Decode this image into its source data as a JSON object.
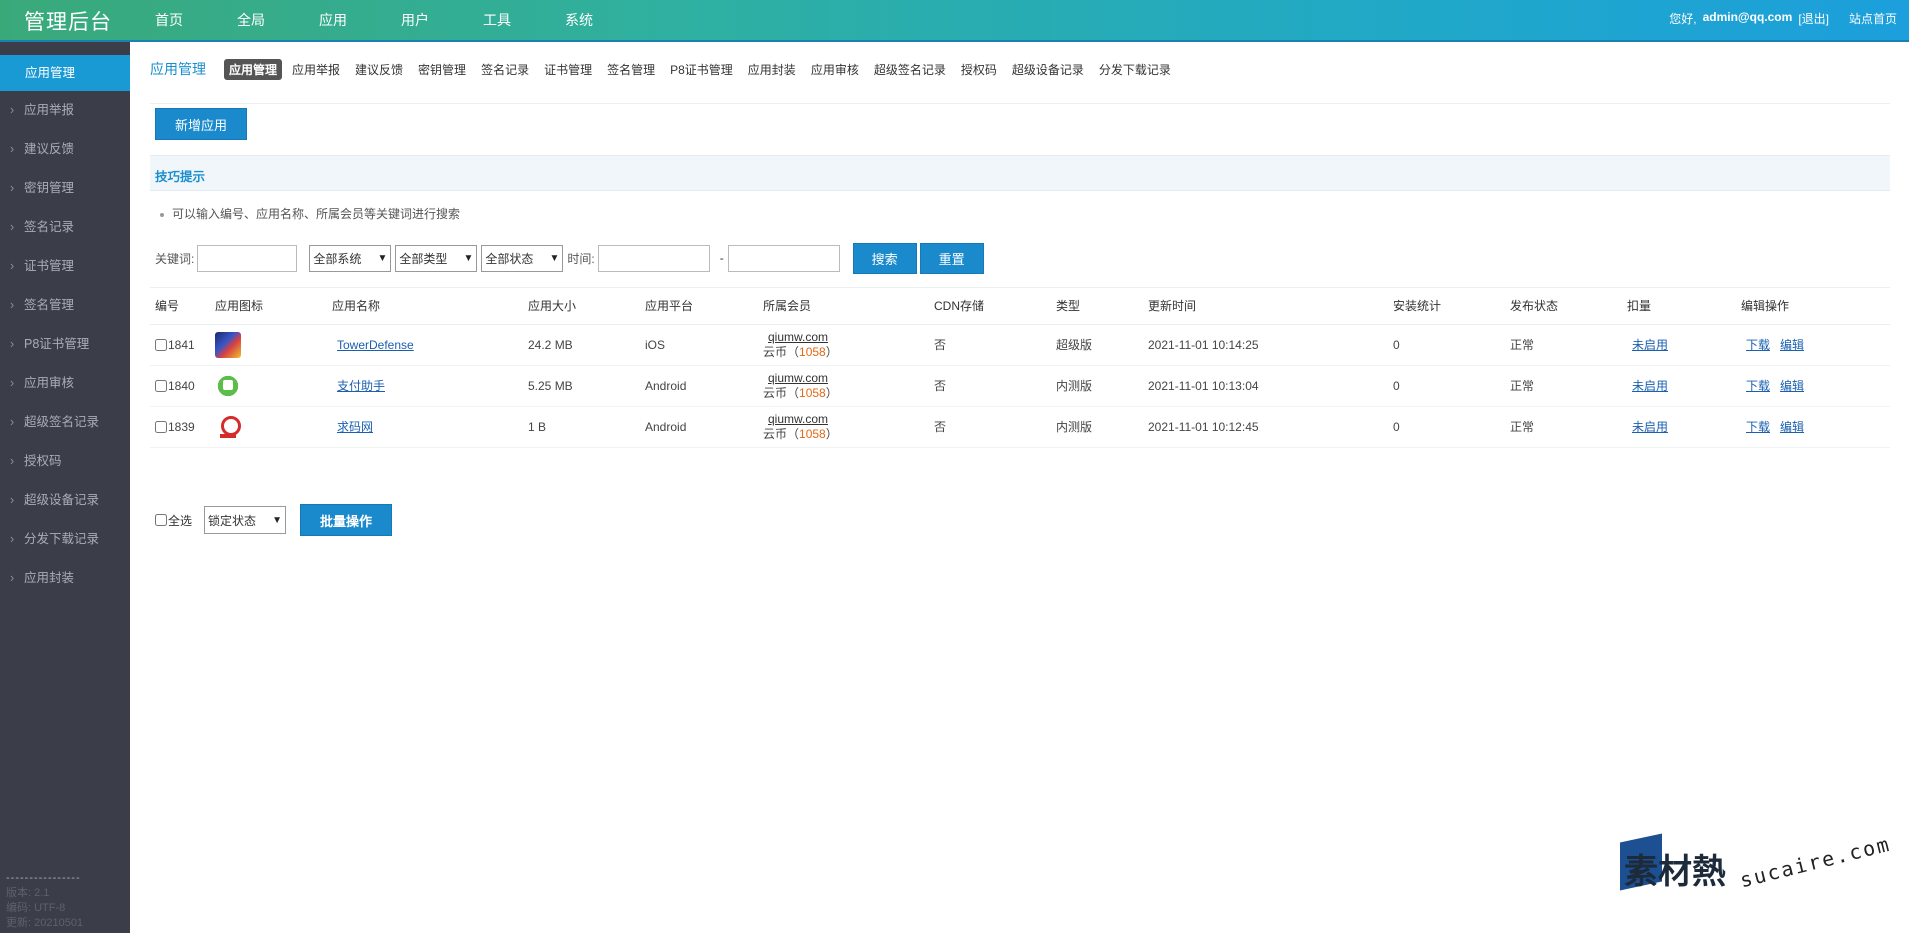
{
  "header": {
    "brand": "管理后台",
    "nav": [
      "首页",
      "全局",
      "应用",
      "用户",
      "工具",
      "系统"
    ],
    "greeting": "您好,",
    "user_email": "admin@qq.com",
    "logout": "[退出]",
    "site_home": "站点首页"
  },
  "sidebar": {
    "items": [
      "应用管理",
      "应用举报",
      "建议反馈",
      "密钥管理",
      "签名记录",
      "证书管理",
      "签名管理",
      "P8证书管理",
      "应用审核",
      "超级签名记录",
      "授权码",
      "超级设备记录",
      "分发下载记录",
      "应用封装"
    ],
    "footer": {
      "divider": "----------------",
      "version": "版本: 2.1",
      "encoding": "编码: UTF-8",
      "updated": "更新: 20210501"
    }
  },
  "subnav": {
    "title": "应用管理",
    "tabs": [
      "应用管理",
      "应用举报",
      "建议反馈",
      "密钥管理",
      "签名记录",
      "证书管理",
      "签名管理",
      "P8证书管理",
      "应用封装",
      "应用审核",
      "超级签名记录",
      "授权码",
      "超级设备记录",
      "分发下载记录"
    ]
  },
  "add_button": "新增应用",
  "tips": {
    "title": "技巧提示",
    "line": "可以输入编号、应用名称、所属会员等关键词进行搜索"
  },
  "search": {
    "keyword_label": "关键词:",
    "keyword_value": "",
    "system_select": "全部系统",
    "type_select": "全部类型",
    "status_select": "全部状态",
    "time_label": "时间:",
    "time_sep": "-",
    "search_btn": "搜索",
    "reset_btn": "重置"
  },
  "table": {
    "headers": [
      "编号",
      "应用图标",
      "应用名称",
      "应用大小",
      "应用平台",
      "所属会员",
      "CDN存储",
      "类型",
      "更新时间",
      "安装统计",
      "发布状态",
      "扣量",
      "编辑操作"
    ],
    "rows": [
      {
        "id": "1841",
        "icon": "tower-defense-icon",
        "name": "TowerDefense",
        "size": "24.2 MB",
        "platform": "iOS",
        "member": "qiumw.com",
        "coin_label": "云币（",
        "coins": "1058",
        "coin_end": "）",
        "cdn": "否",
        "type": "超级版",
        "updated": "2021-11-01 10:14:25",
        "installs": "0",
        "status": "正常",
        "deduct": "未启用",
        "op_download": "下载",
        "op_edit": "编辑"
      },
      {
        "id": "1840",
        "icon": "payment-helper-icon",
        "name": "支付助手",
        "size": "5.25 MB",
        "platform": "Android",
        "member": "qiumw.com",
        "coin_label": "云币（",
        "coins": "1058",
        "coin_end": "）",
        "cdn": "否",
        "type": "内测版",
        "updated": "2021-11-01 10:13:04",
        "installs": "0",
        "status": "正常",
        "deduct": "未启用",
        "op_download": "下载",
        "op_edit": "编辑"
      },
      {
        "id": "1839",
        "icon": "qiuma-icon",
        "name": "求码网",
        "size": "1 B",
        "platform": "Android",
        "member": "qiumw.com",
        "coin_label": "云币（",
        "coins": "1058",
        "coin_end": "）",
        "cdn": "否",
        "type": "内测版",
        "updated": "2021-11-01 10:12:45",
        "installs": "0",
        "status": "正常",
        "deduct": "未启用",
        "op_download": "下载",
        "op_edit": "编辑"
      }
    ]
  },
  "batch": {
    "select_all": "全选",
    "lock_select": "锁定状态",
    "batch_btn": "批量操作"
  },
  "watermark": {
    "cn": "素材熱",
    "en": "sucaire.com"
  }
}
